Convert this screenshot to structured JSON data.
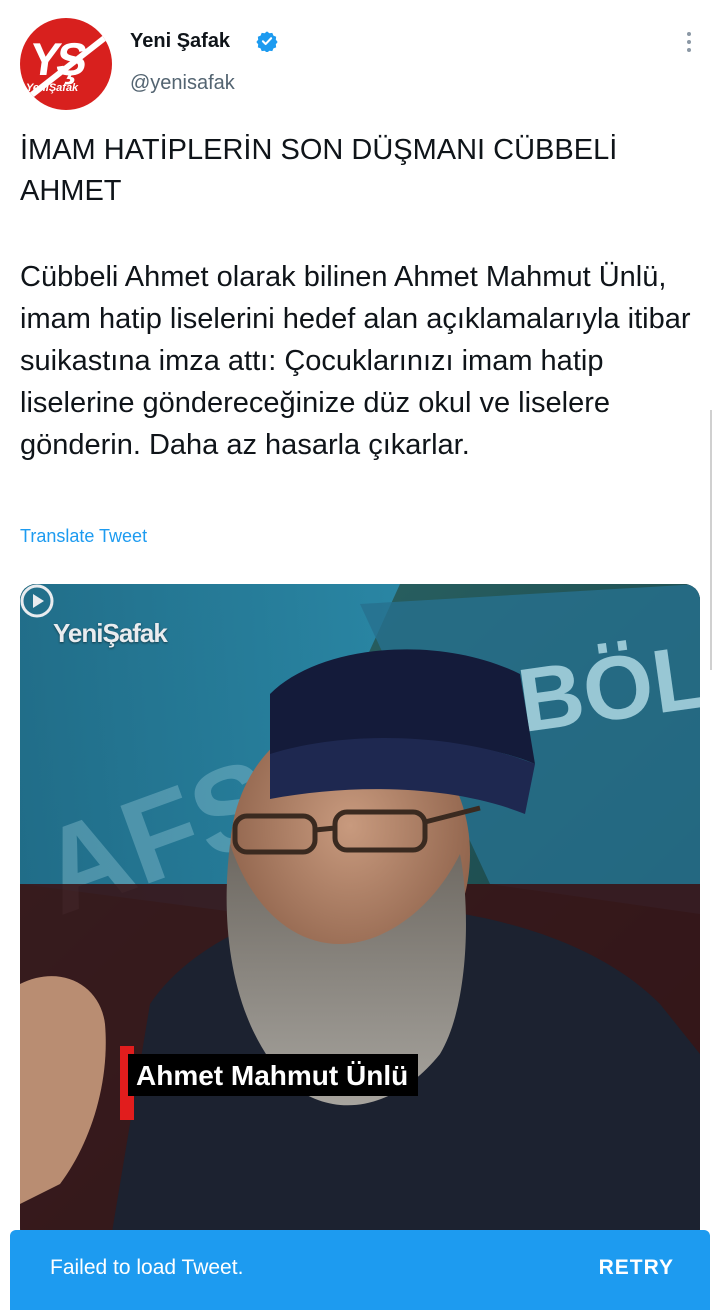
{
  "tweet": {
    "author_name": "Yeni Şafak",
    "author_handle": "@yenisafak",
    "avatar_text": "YŞ",
    "avatar_brand": "YeniŞafak",
    "headline": "İMAM HATİPLERİN SON DÜŞMANI CÜBBELİ AHMET",
    "body": "Cübbeli Ahmet olarak bilinen Ahmet Mahmut Ünlü, imam hatip liselerini hedef alan açıklamalarıyla itibar suikastına imza attı: Çocuklarınızı imam hatip liselerine göndereceğinize düz okul ve liselere gönderin. Daha az hasarla çıkarlar.",
    "translate_label": "Translate Tweet"
  },
  "media": {
    "watermark": "YeniŞafak",
    "caption": "Ahmet Mahmut Ünlü",
    "background_text": "BÖL"
  },
  "toast": {
    "message": "Failed to load Tweet.",
    "action_label": "RETRY"
  },
  "colors": {
    "accent": "#1d9bf0",
    "avatar_red": "#d8201e",
    "caption_red": "#e11d1d"
  },
  "icons": [
    "verified-badge-icon",
    "more-options-icon",
    "play-icon"
  ]
}
